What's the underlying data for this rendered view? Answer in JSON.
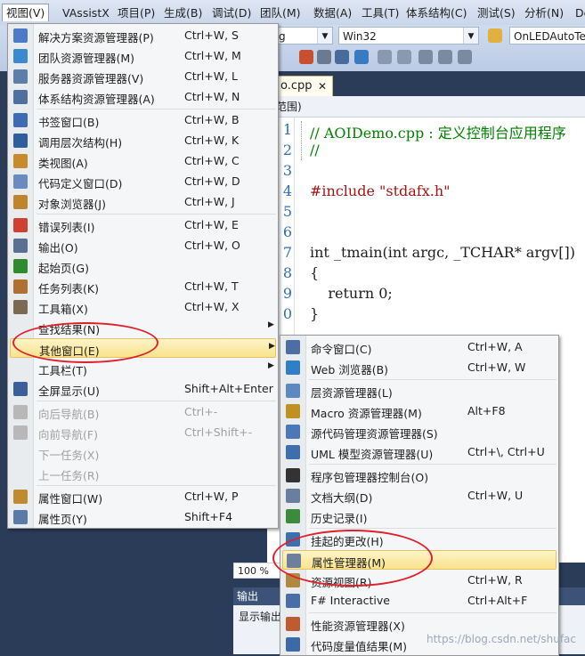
{
  "menubar": [
    "视图(V)",
    "VAssistX",
    "项目(P)",
    "生成(B)",
    "调试(D)",
    "团队(M)",
    "数据(A)",
    "工具(T)",
    "体系结构(C)",
    "测试(S)",
    "分析(N)",
    "De"
  ],
  "toolbar": {
    "config": "g",
    "platform": "Win32",
    "project": "OnLEDAutoTe"
  },
  "doc_tab": "o.cpp",
  "scope": "范围)",
  "code_lines": [
    {
      "n": "1",
      "t": "// AOIDemo.cpp : 定义控制台应用程序",
      "c": "cmt"
    },
    {
      "n": "2",
      "t": "//",
      "c": "cmt"
    },
    {
      "n": "3",
      "t": "",
      "c": ""
    },
    {
      "n": "4",
      "t": "#include \"stdafx.h\"",
      "c": "inc"
    },
    {
      "n": "5",
      "t": "",
      "c": ""
    },
    {
      "n": "6",
      "t": "",
      "c": ""
    },
    {
      "n": "7",
      "t": "int _tmain(int argc, _TCHAR* argv[])",
      "c": "main"
    },
    {
      "n": "8",
      "t": "{",
      "c": ""
    },
    {
      "n": "9",
      "t": "    return 0;",
      "c": "ret"
    },
    {
      "n": "0",
      "t": "}",
      "c": ""
    }
  ],
  "zoom": "100 %",
  "output": {
    "title": "输出",
    "label": "显示输出"
  },
  "view_menu": [
    {
      "label": "解决方案资源管理器(P)",
      "shortcut": "Ctrl+W, S",
      "icon": "solution-explorer-icon",
      "color": "#4a7bc4"
    },
    {
      "label": "团队资源管理器(M)",
      "shortcut": "Ctrl+W, M",
      "icon": "team-explorer-icon",
      "color": "#3a8acf"
    },
    {
      "label": "服务器资源管理器(V)",
      "shortcut": "Ctrl+W, L",
      "icon": "server-explorer-icon",
      "color": "#5b7fa8"
    },
    {
      "label": "体系结构资源管理器(A)",
      "shortcut": "Ctrl+W, N",
      "icon": "architecture-explorer-icon",
      "color": "#4f6fa0"
    },
    {
      "sep": true
    },
    {
      "label": "书签窗口(B)",
      "shortcut": "Ctrl+W, B",
      "icon": "bookmark-icon",
      "color": "#3d6bb5"
    },
    {
      "label": "调用层次结构(H)",
      "shortcut": "Ctrl+W, K",
      "icon": "call-hierarchy-icon",
      "color": "#2f5e9c"
    },
    {
      "label": "类视图(A)",
      "shortcut": "Ctrl+W, C",
      "icon": "class-view-icon",
      "color": "#c98a2a"
    },
    {
      "label": "代码定义窗口(D)",
      "shortcut": "Ctrl+W, D",
      "icon": "code-definition-icon",
      "color": "#6a8ac0"
    },
    {
      "label": "对象浏览器(J)",
      "shortcut": "Ctrl+W, J",
      "icon": "object-browser-icon",
      "color": "#c0842a"
    },
    {
      "sep": true
    },
    {
      "label": "错误列表(I)",
      "shortcut": "Ctrl+W, E",
      "icon": "error-list-icon",
      "color": "#d04030"
    },
    {
      "label": "输出(O)",
      "shortcut": "Ctrl+W, O",
      "icon": "output-icon",
      "color": "#5a7090"
    },
    {
      "label": "起始页(G)",
      "shortcut": "",
      "icon": "start-page-icon",
      "color": "#2e8b2e"
    },
    {
      "label": "任务列表(K)",
      "shortcut": "Ctrl+W, T",
      "icon": "task-list-icon",
      "color": "#b07030"
    },
    {
      "label": "工具箱(X)",
      "shortcut": "Ctrl+W, X",
      "icon": "toolbox-icon",
      "color": "#7a6a50"
    },
    {
      "label": "查找结果(N)",
      "shortcut": "",
      "icon": "",
      "arrow": true
    },
    {
      "label": "其他窗口(E)",
      "shortcut": "",
      "icon": "",
      "arrow": true,
      "highlight": true
    },
    {
      "label": "工具栏(T)",
      "shortcut": "",
      "icon": "",
      "arrow": true
    },
    {
      "label": "全屏显示(U)",
      "shortcut": "Shift+Alt+Enter",
      "icon": "fullscreen-icon",
      "color": "#3c5f9c"
    },
    {
      "sep": true
    },
    {
      "label": "向后导航(B)",
      "shortcut": "Ctrl+-",
      "icon": "navigate-back-icon",
      "color": "#b8b8b8",
      "disabled": true
    },
    {
      "label": "向前导航(F)",
      "shortcut": "Ctrl+Shift+-",
      "icon": "navigate-forward-icon",
      "color": "#b8b8b8",
      "disabled": true
    },
    {
      "label": "下一任务(X)",
      "shortcut": "",
      "icon": "",
      "disabled": true
    },
    {
      "label": "上一任务(R)",
      "shortcut": "",
      "icon": "",
      "disabled": true
    },
    {
      "sep": true
    },
    {
      "label": "属性窗口(W)",
      "shortcut": "Ctrl+W, P",
      "icon": "properties-window-icon",
      "color": "#c08a30"
    },
    {
      "label": "属性页(Y)",
      "shortcut": "Shift+F4",
      "icon": "property-pages-icon",
      "color": "#5a7aa8"
    }
  ],
  "other_windows_menu": [
    {
      "label": "命令窗口(C)",
      "shortcut": "Ctrl+W, A",
      "icon": "command-window-icon",
      "color": "#4b6fa5"
    },
    {
      "label": "Web 浏览器(B)",
      "shortcut": "Ctrl+W, W",
      "icon": "web-browser-icon",
      "color": "#2f7fc8"
    },
    {
      "sep": true
    },
    {
      "label": "层资源管理器(L)",
      "shortcut": "",
      "icon": "layer-explorer-icon",
      "color": "#5a8ac0"
    },
    {
      "label": "Macro 资源管理器(M)",
      "shortcut": "Alt+F8",
      "icon": "macro-explorer-icon",
      "color": "#c09020"
    },
    {
      "label": "源代码管理资源管理器(S)",
      "shortcut": "",
      "icon": "source-control-icon",
      "color": "#4a78b8"
    },
    {
      "label": "UML 模型资源管理器(U)",
      "shortcut": "Ctrl+\\, Ctrl+U",
      "icon": "uml-explorer-icon",
      "color": "#3d6eae"
    },
    {
      "sep": true
    },
    {
      "label": "程序包管理器控制台(O)",
      "shortcut": "",
      "icon": "package-console-icon",
      "color": "#333333"
    },
    {
      "label": "文档大纲(D)",
      "shortcut": "Ctrl+W, U",
      "icon": "document-outline-icon",
      "color": "#6a7fa0"
    },
    {
      "label": "历史记录(I)",
      "shortcut": "",
      "icon": "history-icon",
      "color": "#3c8a3c"
    },
    {
      "sep": true
    },
    {
      "label": "挂起的更改(H)",
      "shortcut": "",
      "icon": "pending-changes-icon",
      "color": "#3a6fb0"
    },
    {
      "label": "属性管理器(M)",
      "shortcut": "",
      "icon": "property-manager-icon",
      "color": "#6d7f9c",
      "highlight": true
    },
    {
      "label": "资源视图(R)",
      "shortcut": "Ctrl+W, R",
      "icon": "resource-view-icon",
      "color": "#b08840"
    },
    {
      "label": "F# Interactive",
      "shortcut": "Ctrl+Alt+F",
      "icon": "fsharp-interactive-icon",
      "color": "#4a6fa8"
    },
    {
      "sep": true
    },
    {
      "label": "性能资源管理器(X)",
      "shortcut": "",
      "icon": "performance-explorer-icon",
      "color": "#c05a30"
    },
    {
      "label": "代码度量值结果(M)",
      "shortcut": "",
      "icon": "code-metrics-icon",
      "color": "#3c6aa8"
    }
  ],
  "watermark": "https://blog.csdn.net/shufac"
}
